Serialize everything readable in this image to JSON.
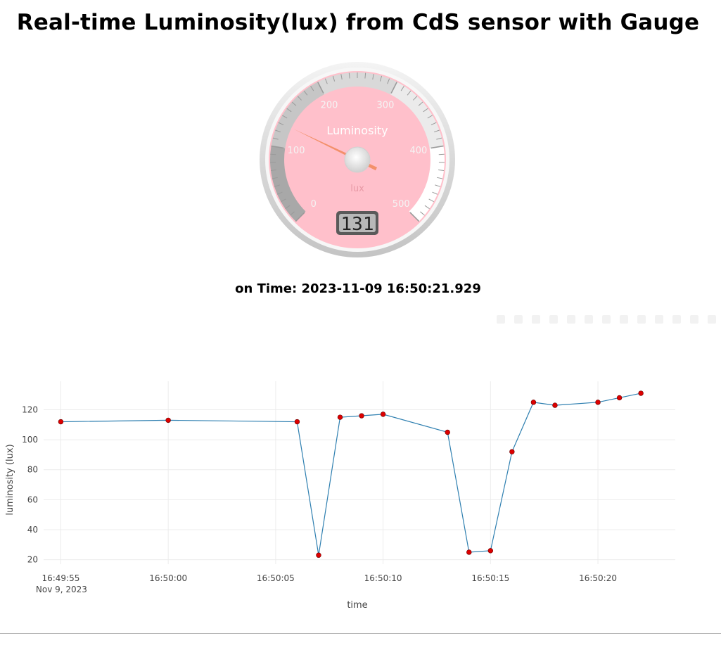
{
  "page": {
    "title": "Real-time Luminosity(lux) from CdS sensor with Gauge",
    "time_line": "on Time: 2023-11-09 16:50:21.929"
  },
  "gauge": {
    "title": "Luminosity",
    "units": "lux",
    "min": 0,
    "max": 500,
    "value": 131,
    "value_display": "131",
    "major_ticks": [
      "0",
      "100",
      "200",
      "300",
      "400",
      "500"
    ],
    "highlights": [
      {
        "from": 0,
        "to": 100,
        "color": "#a8a8a8"
      },
      {
        "from": 100,
        "to": 200,
        "color": "#c6c6c6"
      },
      {
        "from": 200,
        "to": 300,
        "color": "#d9d9d9"
      },
      {
        "from": 300,
        "to": 400,
        "color": "#ebebeb"
      },
      {
        "from": 400,
        "to": 500,
        "color": "#ffffff"
      }
    ],
    "plate_color": "#ffc0cb",
    "needle_color": "#f3906a"
  },
  "modebar": {
    "icons": [
      "camera-icon",
      "zoom-icon",
      "pan-icon",
      "box-select-icon",
      "lasso-select-icon",
      "zoom-in-icon",
      "zoom-out-icon",
      "autoscale-icon",
      "reset-axes-icon",
      "spike-lines-icon",
      "hover-closest-icon",
      "hover-compare-icon",
      "plotly-logo-icon"
    ]
  },
  "chart_data": {
    "type": "line",
    "xlabel": "time",
    "ylabel": "luminosity (lux)",
    "x": [
      "16:49:55",
      "16:50:00",
      "16:50:06",
      "16:50:07",
      "16:50:08",
      "16:50:09",
      "16:50:10",
      "16:50:13",
      "16:50:14",
      "16:50:15",
      "16:50:16",
      "16:50:17",
      "16:50:18",
      "16:50:20",
      "16:50:21",
      "16:50:22"
    ],
    "y": [
      112,
      113,
      112,
      23,
      115,
      116,
      117,
      105,
      25,
      26,
      92,
      125,
      123,
      125,
      128,
      131
    ],
    "x_ticks": [
      "16:49:55",
      "16:50:00",
      "16:50:05",
      "16:50:10",
      "16:50:15",
      "16:50:20"
    ],
    "x_tick_sub": "Nov 9, 2023",
    "y_ticks": [
      20,
      40,
      60,
      80,
      100,
      120
    ],
    "ylim": [
      17,
      139
    ],
    "xlim": [
      "16:49:54.2",
      "16:50:23.6"
    ],
    "grid": true,
    "line_color": "#2e7fb0",
    "marker_color": "#dd0000"
  }
}
